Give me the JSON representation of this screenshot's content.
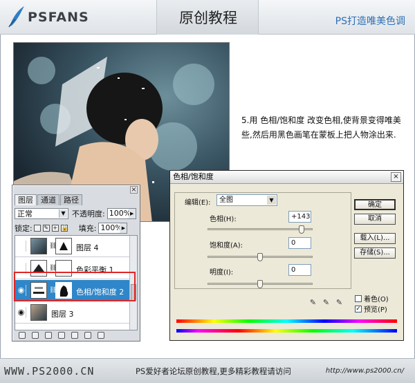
{
  "header": {
    "logo_text": "PSFANS",
    "title": "原创教程",
    "subtitle": "PS打造唯美色调"
  },
  "description": "5.用 色相/饱和度 改变色相,使背景变得唯美些,然后用黑色画笔在蒙板上把人物涂出来.",
  "layers_panel": {
    "tabs": [
      "图层",
      "通道",
      "路径"
    ],
    "blend_mode": "正常",
    "opacity_label": "不透明度:",
    "opacity_value": "100%",
    "lock_label": "锁定:",
    "fill_label": "填充:",
    "fill_value": "100%",
    "layers": [
      {
        "name": "图层 4",
        "visible": false,
        "selected": false
      },
      {
        "name": "色彩平衡 1",
        "visible": false,
        "selected": false
      },
      {
        "name": "色相/饱和度 2",
        "visible": true,
        "selected": true
      },
      {
        "name": "图层 3",
        "visible": true,
        "selected": false
      }
    ]
  },
  "hue_dialog": {
    "title": "色相/饱和度",
    "edit_label": "编辑(E):",
    "edit_value": "全图",
    "hue_label": "色相(H):",
    "hue_value": "+143",
    "saturation_label": "饱和度(A):",
    "saturation_value": "0",
    "lightness_label": "明度(I):",
    "lightness_value": "0",
    "hue_level": 143,
    "saturation_level": 0,
    "lightness_level": 0,
    "ok_label": "确定",
    "cancel_label": "取消",
    "load_label": "载入(L)...",
    "save_label": "存储(S)...",
    "colorize_label": "着色(O)",
    "colorize_checked": false,
    "preview_label": "预览(P)",
    "preview_checked": true
  },
  "footer": {
    "site": "WWW.PS2000.CN",
    "text": "PS爱好者论坛原创教程,更多精彩教程请访问",
    "url": "http://www.ps2000.cn/"
  },
  "colors": {
    "selection_blue": "#2f86c8",
    "highlight_red": "#e02525",
    "title_blue": "#2d6fb6"
  }
}
